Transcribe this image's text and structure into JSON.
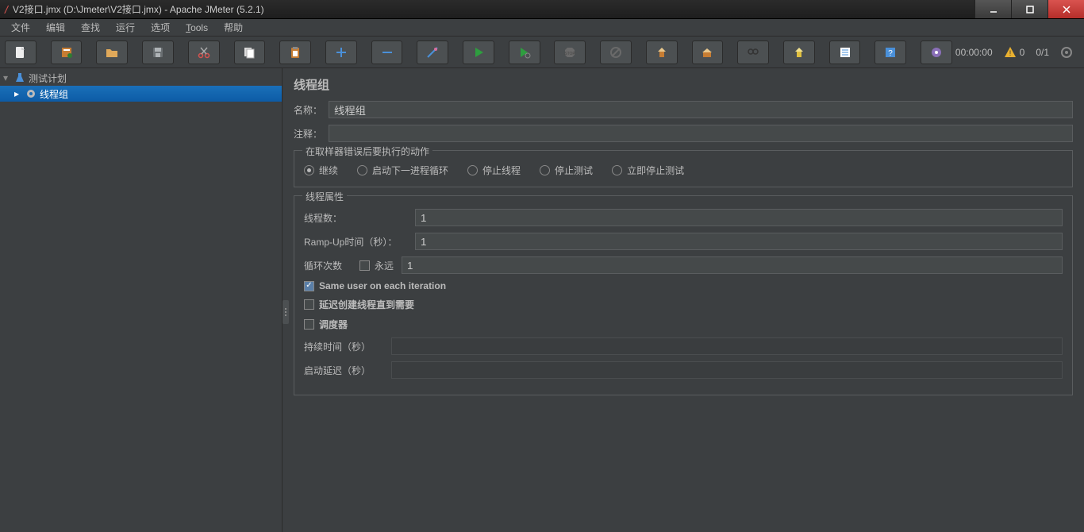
{
  "window": {
    "title": "V2接口.jmx (D:\\Jmeter\\V2接口.jmx) - Apache JMeter (5.2.1)"
  },
  "menu": {
    "file": "文件",
    "edit": "编辑",
    "search": "查找",
    "run": "运行",
    "options": "选项",
    "tools": "Tools",
    "help": "帮助"
  },
  "toolbar_icons": {
    "new": "new-file-icon",
    "templates": "templates-icon",
    "open": "open-icon",
    "save": "save-icon",
    "cut": "cut-icon",
    "copy": "copy-icon",
    "paste": "paste-icon",
    "plus": "plus-icon",
    "minus": "minus-icon",
    "wand": "wand-icon",
    "start": "start-icon",
    "start_no_timers": "start-no-timers-icon",
    "stop": "stop-icon",
    "shutdown": "shutdown-icon",
    "clear": "clear-icon",
    "clear_all": "clear-all-icon",
    "search": "search-icon",
    "reset_search": "reset-search-icon",
    "function": "function-icon",
    "help": "help-icon",
    "heap": "heap-icon"
  },
  "status": {
    "time": "00:00:00",
    "warn_count": "0",
    "threads": "0/1"
  },
  "tree": {
    "root": "测试计划",
    "child": "线程组"
  },
  "panel": {
    "title": "线程组",
    "name_label": "名称：",
    "name_value": "线程组",
    "comment_label": "注释：",
    "comment_value": "",
    "on_error_legend": "在取样器错误后要执行的动作",
    "radio_continue": "继续",
    "radio_next_loop": "启动下一进程循环",
    "radio_stop_thread": "停止线程",
    "radio_stop_test": "停止测试",
    "radio_stop_now": "立即停止测试",
    "thread_props_legend": "线程属性",
    "threads_label": "线程数：",
    "threads_value": "1",
    "rampup_label": "Ramp-Up时间（秒）：",
    "rampup_value": "1",
    "loop_label": "循环次数",
    "loop_forever": "永远",
    "loop_value": "1",
    "same_user": "Same user on each iteration",
    "delay_create": "延迟创建线程直到需要",
    "scheduler": "调度器",
    "duration_label": "持续时间（秒）",
    "startup_delay_label": "启动延迟（秒）"
  }
}
